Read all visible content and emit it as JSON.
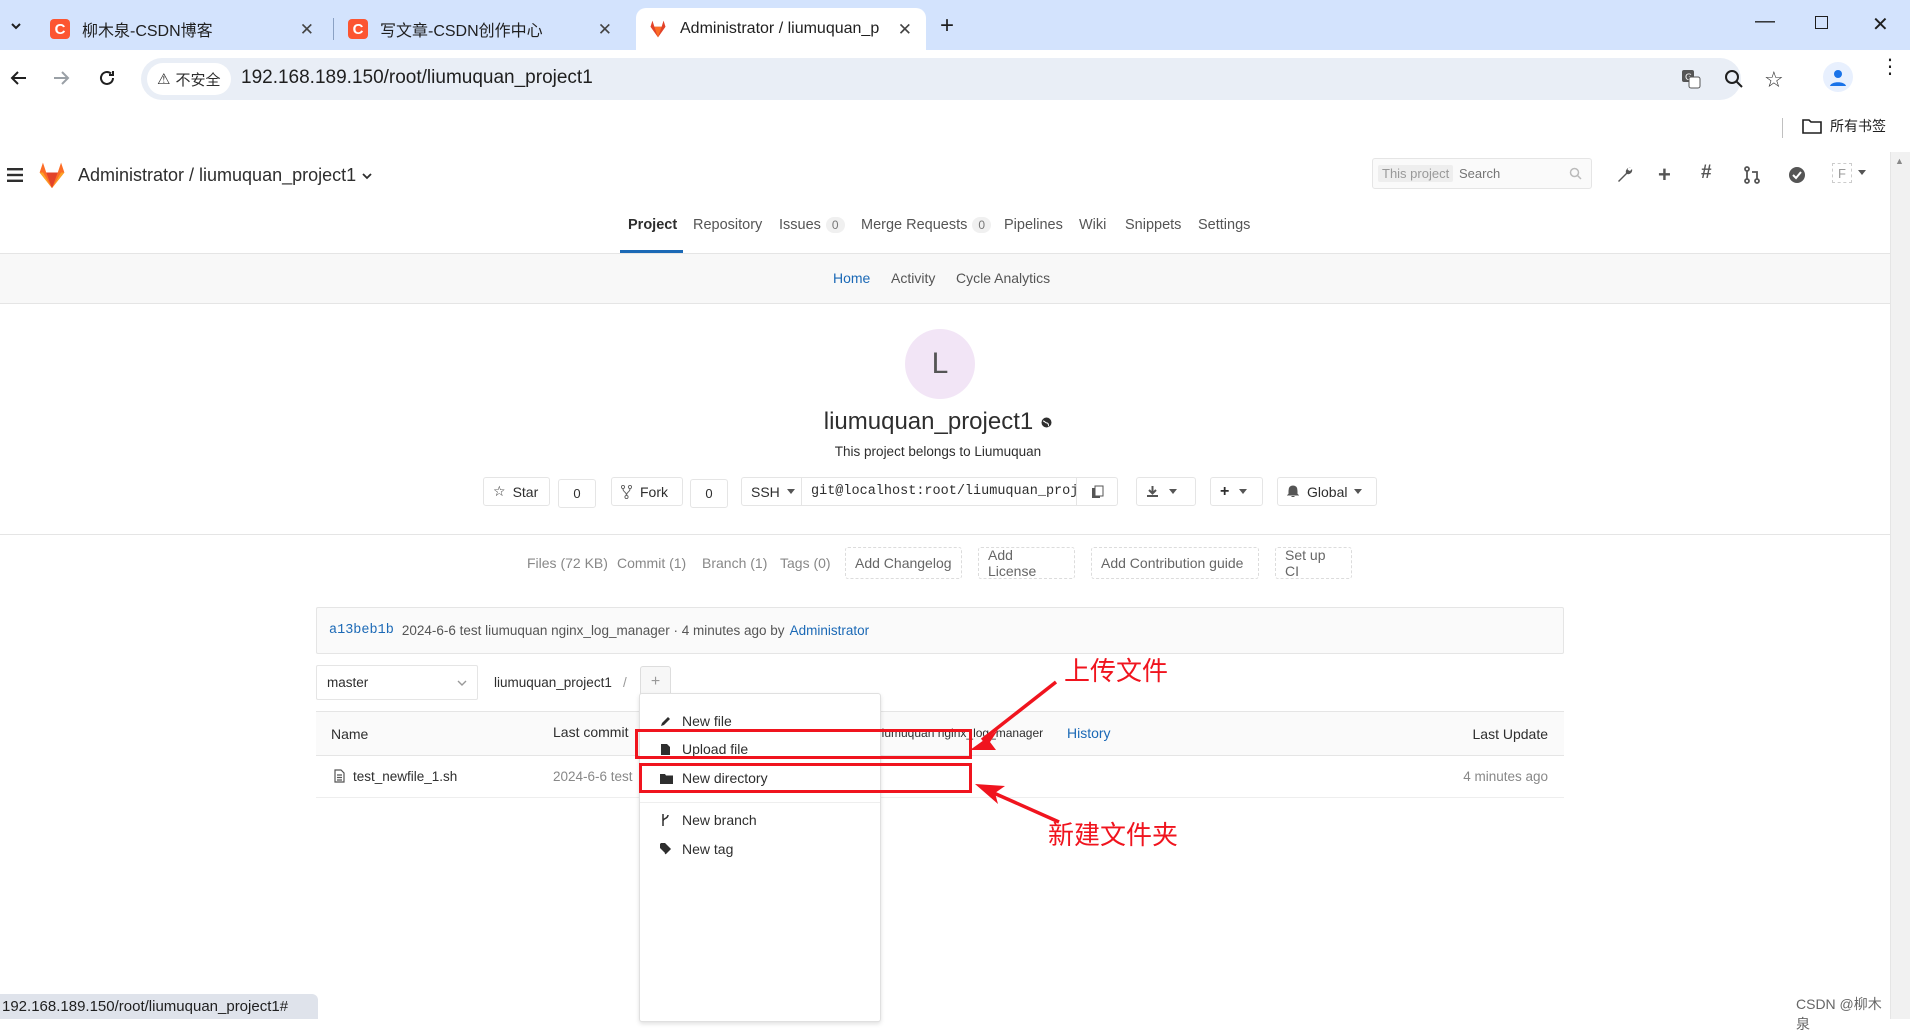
{
  "browser": {
    "tabs": [
      {
        "title": "柳木泉-CSDN博客",
        "favicon": "C"
      },
      {
        "title": "写文章-CSDN创作中心",
        "favicon": "C"
      },
      {
        "title": "Administrator / liumuquan_p",
        "favicon": "gitlab"
      }
    ],
    "security_label": "不安全",
    "url": "192.168.189.150/root/liumuquan_project1",
    "bookmarks_label": "所有书签",
    "status_url": "192.168.189.150/root/liumuquan_project1#"
  },
  "header": {
    "breadcrumb": "Administrator / liumuquan_project1",
    "search_scope": "This project",
    "search_placeholder": "Search",
    "avatar_alt": "F"
  },
  "nav": {
    "tabs": [
      {
        "label": "Project",
        "count": null,
        "active": true
      },
      {
        "label": "Repository",
        "count": null
      },
      {
        "label": "Issues",
        "count": "0"
      },
      {
        "label": "Merge Requests",
        "count": "0"
      },
      {
        "label": "Pipelines",
        "count": null
      },
      {
        "label": "Wiki",
        "count": null
      },
      {
        "label": "Snippets",
        "count": null
      },
      {
        "label": "Settings",
        "count": null
      }
    ],
    "subtabs": [
      {
        "label": "Home",
        "active": true
      },
      {
        "label": "Activity"
      },
      {
        "label": "Cycle Analytics"
      }
    ]
  },
  "project": {
    "avatar_letter": "L",
    "name": "liumuquan_project1",
    "description": "This project belongs to Liumuquan",
    "star_label": "Star",
    "star_count": "0",
    "fork_label": "Fork",
    "fork_count": "0",
    "clone_protocol": "SSH",
    "clone_url": "git@localhost:root/liumuquan_proj",
    "notification_label": "Global"
  },
  "stats": {
    "files": "Files (72 KB)",
    "commits": "Commit (1)",
    "branches": "Branch (1)",
    "tags": "Tags (0)",
    "add_changelog": "Add Changelog",
    "add_license": "Add License",
    "add_contribution": "Add Contribution guide",
    "setup_ci": "Set up CI"
  },
  "commit": {
    "sha": "a13beb1b",
    "message": "2024-6-6 test liumuquan nginx_log_manager · 4 minutes ago by",
    "author": "Administrator"
  },
  "tree": {
    "branch": "master",
    "path": "liumuquan_project1",
    "path_sep": "/",
    "add_icon": "+",
    "header_name": "Name",
    "header_last_commit": "Last commit",
    "header_commit_msg": "liumuquan nginx_log_manager",
    "header_history": "History",
    "header_last_update": "Last Update",
    "rows": [
      {
        "name": "test_newfile_1.sh",
        "commit": "2024-6-6 test",
        "updated": "4 minutes ago"
      }
    ]
  },
  "dropdown": {
    "new_file": "New file",
    "upload_file": "Upload file",
    "new_directory": "New directory",
    "new_branch": "New branch",
    "new_tag": "New tag"
  },
  "annotations": {
    "upload": "上传文件",
    "new_folder": "新建文件夹",
    "highlight_color": "#f0141e"
  },
  "watermark": "CSDN @柳木泉",
  "colors": {
    "link": "#1b69b6",
    "gitlab_orange": "#e24329",
    "csdn_red": "#fc5531",
    "tab_strip": "#d3e3fd"
  }
}
